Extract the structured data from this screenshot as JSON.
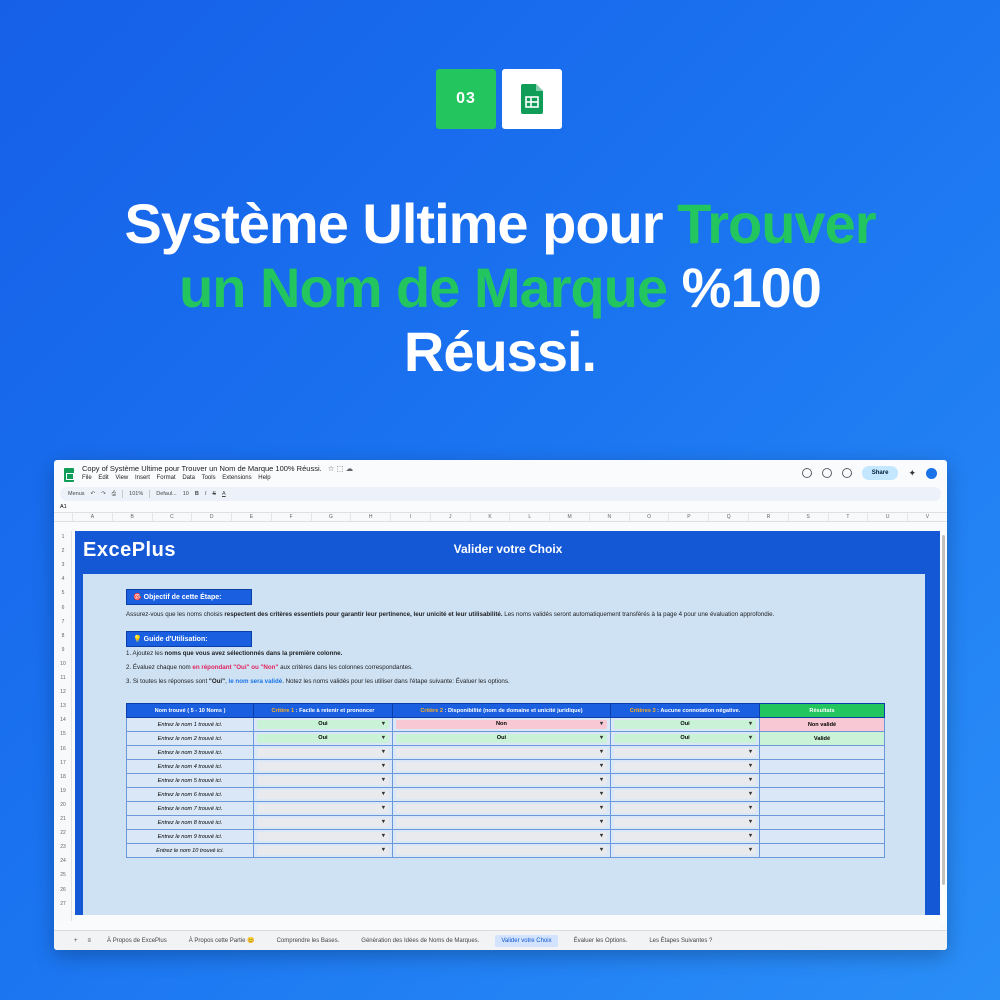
{
  "step": "03",
  "headline": {
    "line1_white": "Système Ultime pour ",
    "line1_green": "Trouver",
    "line2_green": "un Nom de Marque",
    "line2_white": " %100",
    "line3_white": "Réussi."
  },
  "window": {
    "doc_title": "Copy of Système Ultime pour Trouver un Nom de Marque 100% Réussi.",
    "menus": [
      "File",
      "Edit",
      "View",
      "Insert",
      "Format",
      "Data",
      "Tools",
      "Extensions",
      "Help"
    ],
    "share_label": "Share",
    "toolbar": {
      "search": "Menus",
      "zoom": "101%",
      "font": "Defaul...",
      "size": "10"
    },
    "cell_ref": "A1",
    "columns": [
      "A",
      "B",
      "C",
      "D",
      "E",
      "F",
      "G",
      "H",
      "I",
      "J",
      "K",
      "L",
      "M",
      "N",
      "O",
      "P",
      "Q",
      "R",
      "S",
      "T",
      "U",
      "V"
    ],
    "rows": [
      "1",
      "2",
      "3",
      "4",
      "5",
      "6",
      "7",
      "8",
      "9",
      "10",
      "11",
      "12",
      "13",
      "14",
      "15",
      "16",
      "17",
      "18",
      "19",
      "20",
      "21",
      "22",
      "23",
      "24",
      "25",
      "26",
      "27"
    ]
  },
  "sheet": {
    "brand": "ExcePlus",
    "title": "Valider votre Choix",
    "objective_label": "🎯 Objectif de cette Étape:",
    "objective_text_a": "Assurez-vous que les noms choisis ",
    "objective_text_b": "respectent des critères essentiels pour garantir leur pertinence, leur unicité et leur utilisabilité.",
    "objective_text_c": " Les noms validés seront automatiquement transférés à la page 4 pour une évaluation approfondie.",
    "guide_label": "💡 Guide d'Utilisation:",
    "step1_a": "1. Ajoutez les ",
    "step1_b": "noms que vous avez sélectionnés dans la première colonne.",
    "step2_a": "2. Évaluez chaque nom ",
    "step2_b": "en répondant \"Oui\" ou \"Non\"",
    "step2_c": " aux critères dans les colonnes correspondantes.",
    "step3_a": "3. Si toutes les réponses sont ",
    "step3_b": "\"Oui\"",
    "step3_c": ", ",
    "step3_d": "le nom sera validé",
    "step3_e": ". Notez les noms validés pour les utiliser dans l'étape suivante: Évaluer les options.",
    "table": {
      "h_name": "Nom trouvé ( 5 - 10 Noms )",
      "h_c1_tag": "Critère 1",
      "h_c1": " : Facile à retenir et prononcer",
      "h_c2_tag": "Critère 2",
      "h_c2": " : Disponibilité (nom de domaine et unicité juridique)",
      "h_c3_tag": "Critères 3",
      "h_c3": " : Aucune connotation négative.",
      "h_res": "Résultats",
      "rows": [
        {
          "name": "Entrez le nom 1 trouvé ici.",
          "c1": "Oui",
          "c2": "Non",
          "c3": "Oui",
          "res": "Non validé"
        },
        {
          "name": "Entrez le nom 2 trouvé ici.",
          "c1": "Oui",
          "c2": "Oui",
          "c3": "Oui",
          "res": "Validé"
        },
        {
          "name": "Entrez le nom 3 trouvé ici.",
          "c1": "",
          "c2": "",
          "c3": "",
          "res": ""
        },
        {
          "name": "Entrez le nom 4 trouvé ici.",
          "c1": "",
          "c2": "",
          "c3": "",
          "res": ""
        },
        {
          "name": "Entrez le nom 5 trouvé ici.",
          "c1": "",
          "c2": "",
          "c3": "",
          "res": ""
        },
        {
          "name": "Entrez le nom 6 trouvé ici.",
          "c1": "",
          "c2": "",
          "c3": "",
          "res": ""
        },
        {
          "name": "Entrez le nom 7 trouvé ici.",
          "c1": "",
          "c2": "",
          "c3": "",
          "res": ""
        },
        {
          "name": "Entrez le nom 8 trouvé ici.",
          "c1": "",
          "c2": "",
          "c3": "",
          "res": ""
        },
        {
          "name": "Entrez le nom 9 trouvé ici.",
          "c1": "",
          "c2": "",
          "c3": "",
          "res": ""
        },
        {
          "name": "Entrez le nom 10 trouvé ici.",
          "c1": "",
          "c2": "",
          "c3": "",
          "res": ""
        }
      ]
    }
  },
  "tabs": [
    "À Propos de ExcePlus",
    "À Propos cette Partie 😊",
    "Comprendre les Bases.",
    "Génération des Idées de Noms de Marques.",
    "Valider votre Choix",
    "Évaluer les Options.",
    "Les Étapes Suivantes ?"
  ],
  "active_tab": "Valider votre Choix"
}
